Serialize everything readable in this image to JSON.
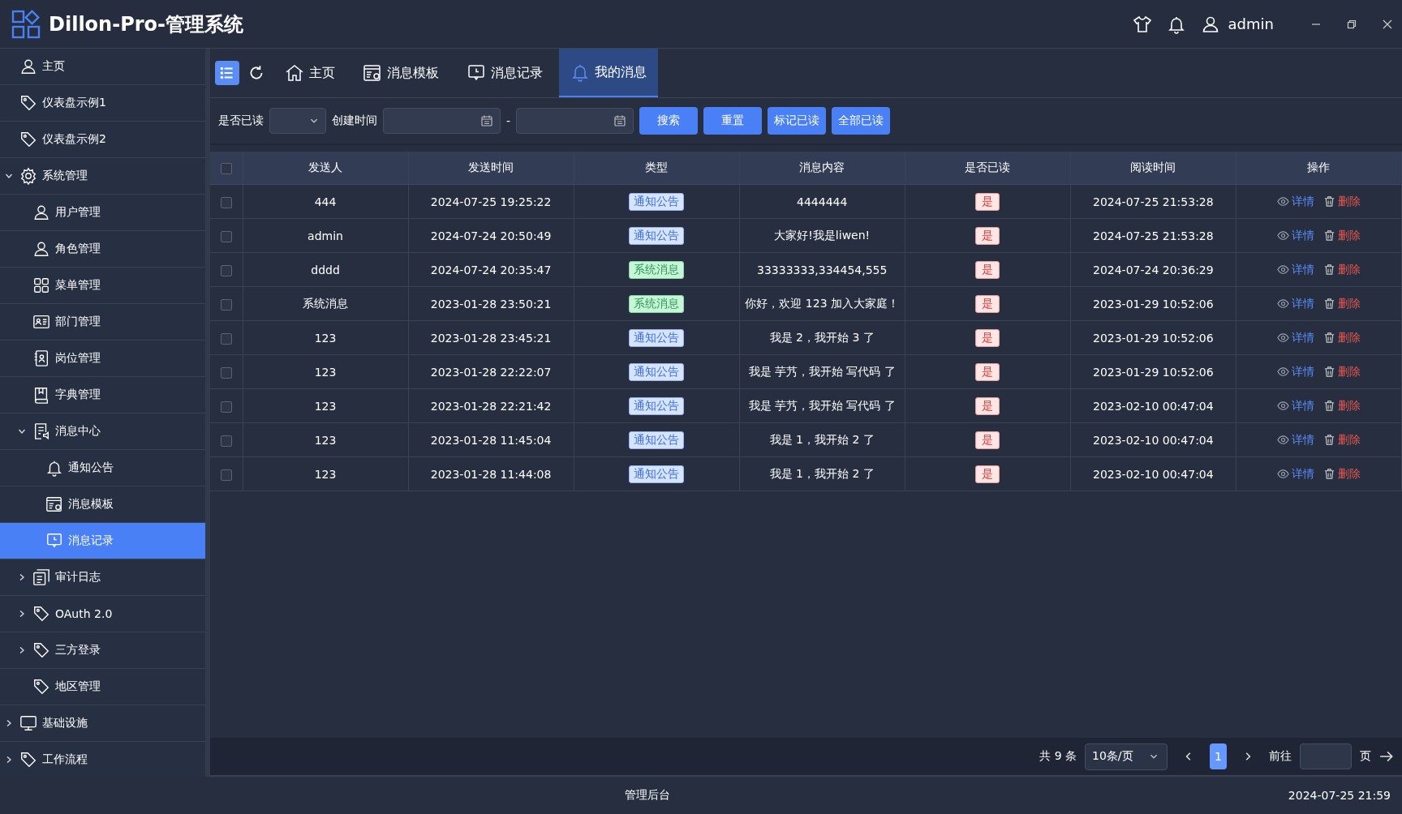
{
  "header": {
    "title": "Dillon-Pro-管理系统",
    "user": "admin"
  },
  "sidebar": {
    "items": [
      {
        "label": "主页",
        "kind": "user",
        "selected": false
      },
      {
        "label": "仪表盘示例1",
        "kind": "tag",
        "selected": false
      },
      {
        "label": "仪表盘示例2",
        "kind": "tag",
        "selected": false
      },
      {
        "label": "系统管理",
        "kind": "gear",
        "selected": false,
        "expanded": true,
        "children": [
          {
            "label": "用户管理",
            "kind": "user",
            "selected": false
          },
          {
            "label": "角色管理",
            "kind": "user",
            "selected": false
          },
          {
            "label": "菜单管理",
            "kind": "grid",
            "selected": false
          },
          {
            "label": "部门管理",
            "kind": "card",
            "selected": false
          },
          {
            "label": "岗位管理",
            "kind": "badge",
            "selected": false
          },
          {
            "label": "字典管理",
            "kind": "book",
            "selected": false
          },
          {
            "label": "消息中心",
            "kind": "doc",
            "selected": false,
            "expanded": true,
            "children": [
              {
                "label": "通知公告",
                "kind": "bell",
                "selected": false
              },
              {
                "label": "消息模板",
                "kind": "template",
                "selected": false
              },
              {
                "label": "消息记录",
                "kind": "chat",
                "selected": true
              }
            ]
          },
          {
            "label": "审计日志",
            "kind": "docs",
            "selected": false,
            "expanded": false
          },
          {
            "label": "OAuth 2.0",
            "kind": "tag",
            "selected": false,
            "expanded": false
          },
          {
            "label": "三方登录",
            "kind": "tag",
            "selected": false,
            "expanded": false
          },
          {
            "label": "地区管理",
            "kind": "tag",
            "selected": false
          }
        ]
      },
      {
        "label": "基础设施",
        "kind": "monitor",
        "selected": false,
        "expanded": false
      },
      {
        "label": "工作流程",
        "kind": "tag",
        "selected": false,
        "expanded": false
      }
    ]
  },
  "tabs": [
    {
      "label": "主页",
      "kind": "home",
      "selected": false
    },
    {
      "label": "消息模板",
      "kind": "template",
      "selected": false
    },
    {
      "label": "消息记录",
      "kind": "chat",
      "selected": false
    },
    {
      "label": "我的消息",
      "kind": "bell",
      "selected": true
    }
  ],
  "filter": {
    "read_label": "是否已读",
    "created_label": "创建时间",
    "range_separator": "-",
    "buttons": [
      "搜索",
      "重置",
      "标记已读",
      "全部已读"
    ]
  },
  "table": {
    "select_all": false,
    "columns": [
      "发送人",
      "发送时间",
      "类型",
      "消息内容",
      "是否已读",
      "阅读时间",
      "操作"
    ],
    "rows": [
      {
        "checked": false,
        "sender": "444",
        "sent": "2024-07-25 19:25:22",
        "type": {
          "kind": "notice",
          "label": "通知公告"
        },
        "content": "4444444",
        "read": "是",
        "read_time": "2024-07-25 21:53:28",
        "actions": [
          "详情",
          "删除"
        ]
      },
      {
        "checked": false,
        "sender": "admin",
        "sent": "2024-07-24 20:50:49",
        "type": {
          "kind": "notice",
          "label": "通知公告"
        },
        "content": "大家好!我是liwen!",
        "read": "是",
        "read_time": "2024-07-25 21:53:28",
        "actions": [
          "详情",
          "删除"
        ]
      },
      {
        "checked": false,
        "sender": "dddd",
        "sent": "2024-07-24 20:35:47",
        "type": {
          "kind": "system",
          "label": "系统消息"
        },
        "content": "33333333,334454,555",
        "read": "是",
        "read_time": "2024-07-24 20:36:29",
        "actions": [
          "详情",
          "删除"
        ]
      },
      {
        "checked": false,
        "sender": "系统消息",
        "sent": "2023-01-28 23:50:21",
        "type": {
          "kind": "system",
          "label": "系统消息"
        },
        "content": "你好，欢迎 123 加入大家庭！",
        "read": "是",
        "read_time": "2023-01-29 10:52:06",
        "actions": [
          "详情",
          "删除"
        ]
      },
      {
        "checked": false,
        "sender": "123",
        "sent": "2023-01-28 23:45:21",
        "type": {
          "kind": "notice",
          "label": "通知公告"
        },
        "content": "我是 2，我开始 3 了",
        "read": "是",
        "read_time": "2023-01-29 10:52:06",
        "actions": [
          "详情",
          "删除"
        ]
      },
      {
        "checked": false,
        "sender": "123",
        "sent": "2023-01-28 22:22:07",
        "type": {
          "kind": "notice",
          "label": "通知公告"
        },
        "content": "我是 芋艿，我开始 写代码 了",
        "read": "是",
        "read_time": "2023-01-29 10:52:06",
        "actions": [
          "详情",
          "删除"
        ]
      },
      {
        "checked": false,
        "sender": "123",
        "sent": "2023-01-28 22:21:42",
        "type": {
          "kind": "notice",
          "label": "通知公告"
        },
        "content": "我是 芋艿，我开始 写代码 了",
        "read": "是",
        "read_time": "2023-02-10 00:47:04",
        "actions": [
          "详情",
          "删除"
        ]
      },
      {
        "checked": false,
        "sender": "123",
        "sent": "2023-01-28 11:45:04",
        "type": {
          "kind": "notice",
          "label": "通知公告"
        },
        "content": "我是 1，我开始 2 了",
        "read": "是",
        "read_time": "2023-02-10 00:47:04",
        "actions": [
          "详情",
          "删除"
        ]
      },
      {
        "checked": false,
        "sender": "123",
        "sent": "2023-01-28 11:44:08",
        "type": {
          "kind": "notice",
          "label": "通知公告"
        },
        "content": "我是 1，我开始 2 了",
        "read": "是",
        "read_time": "2023-02-10 00:47:04",
        "actions": [
          "详情",
          "删除"
        ]
      }
    ]
  },
  "pagination": {
    "total": "共 9 条",
    "page_size": "10条/页",
    "pages": [
      {
        "label": "1",
        "selected": true
      }
    ],
    "goto_label": "前往",
    "page_unit": "页"
  },
  "footer": {
    "center": "管理后台",
    "time": "2024-07-25 21:59"
  }
}
